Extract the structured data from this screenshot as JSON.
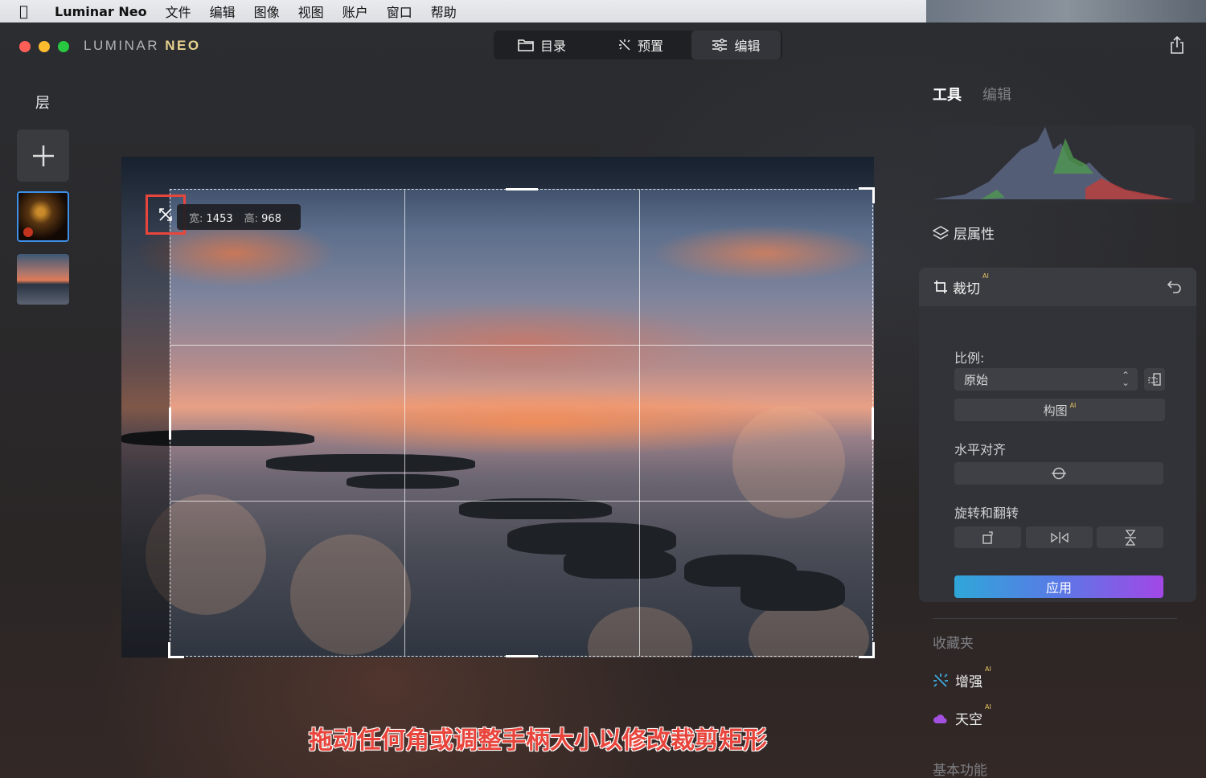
{
  "menubar": {
    "app_name": "Luminar Neo",
    "items": [
      "文件",
      "编辑",
      "图像",
      "视图",
      "账户",
      "窗口",
      "帮助"
    ]
  },
  "window": {
    "logo_main": "LUMINAR",
    "logo_accent": "NEO",
    "nav_tabs": [
      {
        "label": "目录",
        "icon": "folder-icon"
      },
      {
        "label": "预置",
        "icon": "sparkle-icon"
      },
      {
        "label": "编辑",
        "icon": "sliders-icon",
        "active": true
      }
    ]
  },
  "left_panel": {
    "title": "层"
  },
  "canvas": {
    "tooltip": {
      "width_label": "宽:",
      "width_value": "1453",
      "height_label": "高:",
      "height_value": "968"
    },
    "caption": "拖动任何角或调整手柄大小以修改裁剪矩形"
  },
  "right_panel": {
    "tabs": {
      "tools": "工具",
      "edits": "编辑"
    },
    "layer_properties": "层属性",
    "crop": {
      "title": "裁切",
      "ai": "AI",
      "ratio_label": "比例:",
      "ratio_value": "原始",
      "compose_label": "构图",
      "level_label": "水平对齐",
      "rotate_label": "旋转和翻转",
      "apply_label": "应用"
    },
    "favorites": "收藏夹",
    "enhance": "增强",
    "sky": "天空",
    "basic": "基本功能"
  },
  "colors": {
    "accent_blue": "#3d8fe8",
    "highlight_red": "#e8453c",
    "apply_gradient": [
      "#2fa7d8",
      "#a247e6"
    ]
  }
}
